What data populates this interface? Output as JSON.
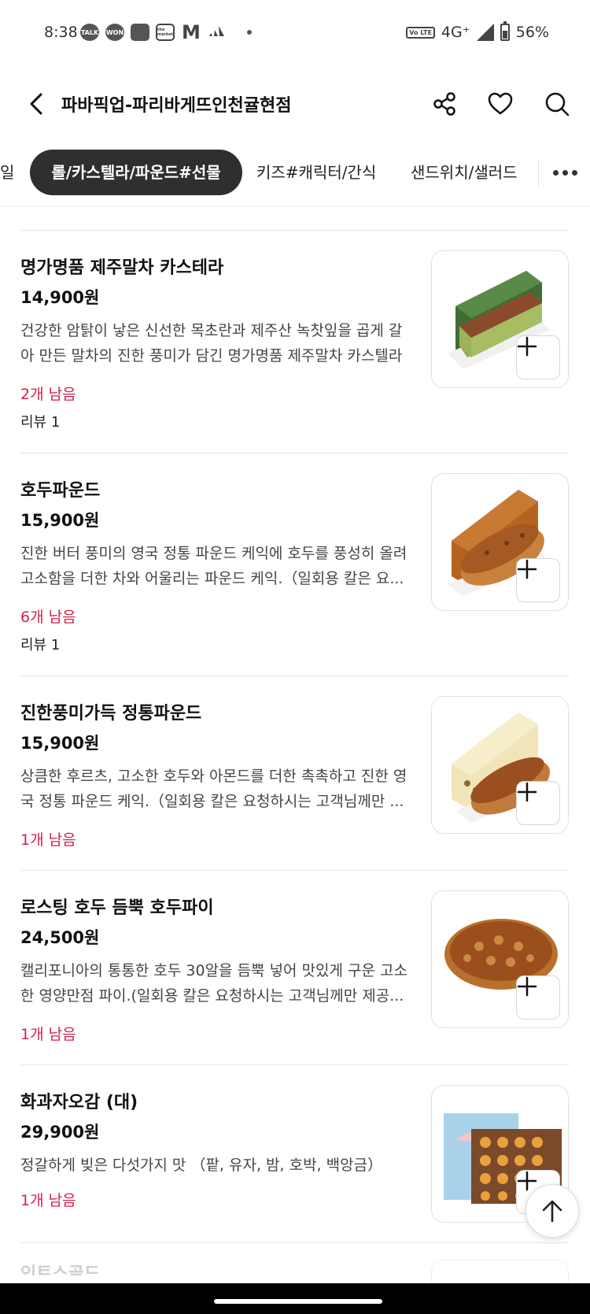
{
  "status_bar": {
    "time": "8:38",
    "notification_icons": [
      "kakaotalk-icon",
      "kakao-won-icon",
      "square-app-icon",
      "the-market-icon",
      "gmail-icon",
      "adidas-icon"
    ],
    "notif_labels": {
      "talk": "TALK",
      "won": "WON",
      "market": "the market"
    },
    "network": "4G⁺",
    "volte": "Vo LTE",
    "battery": "56%"
  },
  "header": {
    "title": "파바픽업-파리바게뜨인천귤현점"
  },
  "tabs": {
    "left_partial": "일",
    "active": "롤/카스텔라/파운드#선물",
    "kids": "키즈#캐릭터/간식",
    "sandwich": "샌드위치/샐러드"
  },
  "products": [
    {
      "name": "명가명품 제주말차 카스테라",
      "price": "14,900원",
      "desc_line1": "건강한 암탉이 낳은 신선한 목초란과 제주산 녹찻잎을 곱게 갈",
      "desc_line2": "아 만든 말차의 진한 풍미가 담긴 명가명품 제주말차 카스텔라",
      "stock": "2개 남음",
      "review": "리뷰 1"
    },
    {
      "name": "호두파운드",
      "price": "15,900원",
      "desc_line1": "진한 버터 풍미의 영국 정통 파운드 케익에 호두를 풍성히 올려",
      "desc_line2": "고소함을 더한 차와 어울리는 파운드 케익.（일회용 칼은 요...",
      "stock": "6개 남음",
      "review": "리뷰 1"
    },
    {
      "name": "진한풍미가득 정통파운드",
      "price": "15,900원",
      "desc_line1": "상큼한 후르츠, 고소한 호두와 아몬드를 더한 촉촉하고 진한 영",
      "desc_line2": "국 정통 파운드 케익.（일회용 칼은 요청하시는 고객님께만 ...",
      "stock": "1개 남음"
    },
    {
      "name": "로스팅 호두 듬뿍 호두파이",
      "price": "24,500원",
      "desc_line1": "캘리포니아의 통통한 호두 30알을 듬뿍 넣어 맛있게 구운 고소",
      "desc_line2": "한 영양만점 파이.(일회용 칼은 요청하시는 고객님께만 제공...",
      "stock": "1개 남음"
    },
    {
      "name": "화과자오감 (대)",
      "price": "29,900원",
      "desc_line1": "정갈하게 빚은 다섯가지 맛 （팥, 유자, 밤, 호박, 백앙금）",
      "stock": "1개 남음"
    }
  ],
  "partial_item_name": "인트스골드",
  "colors": {
    "stock_red": "#d6204a",
    "active_tab_bg": "#2f2f2f"
  }
}
